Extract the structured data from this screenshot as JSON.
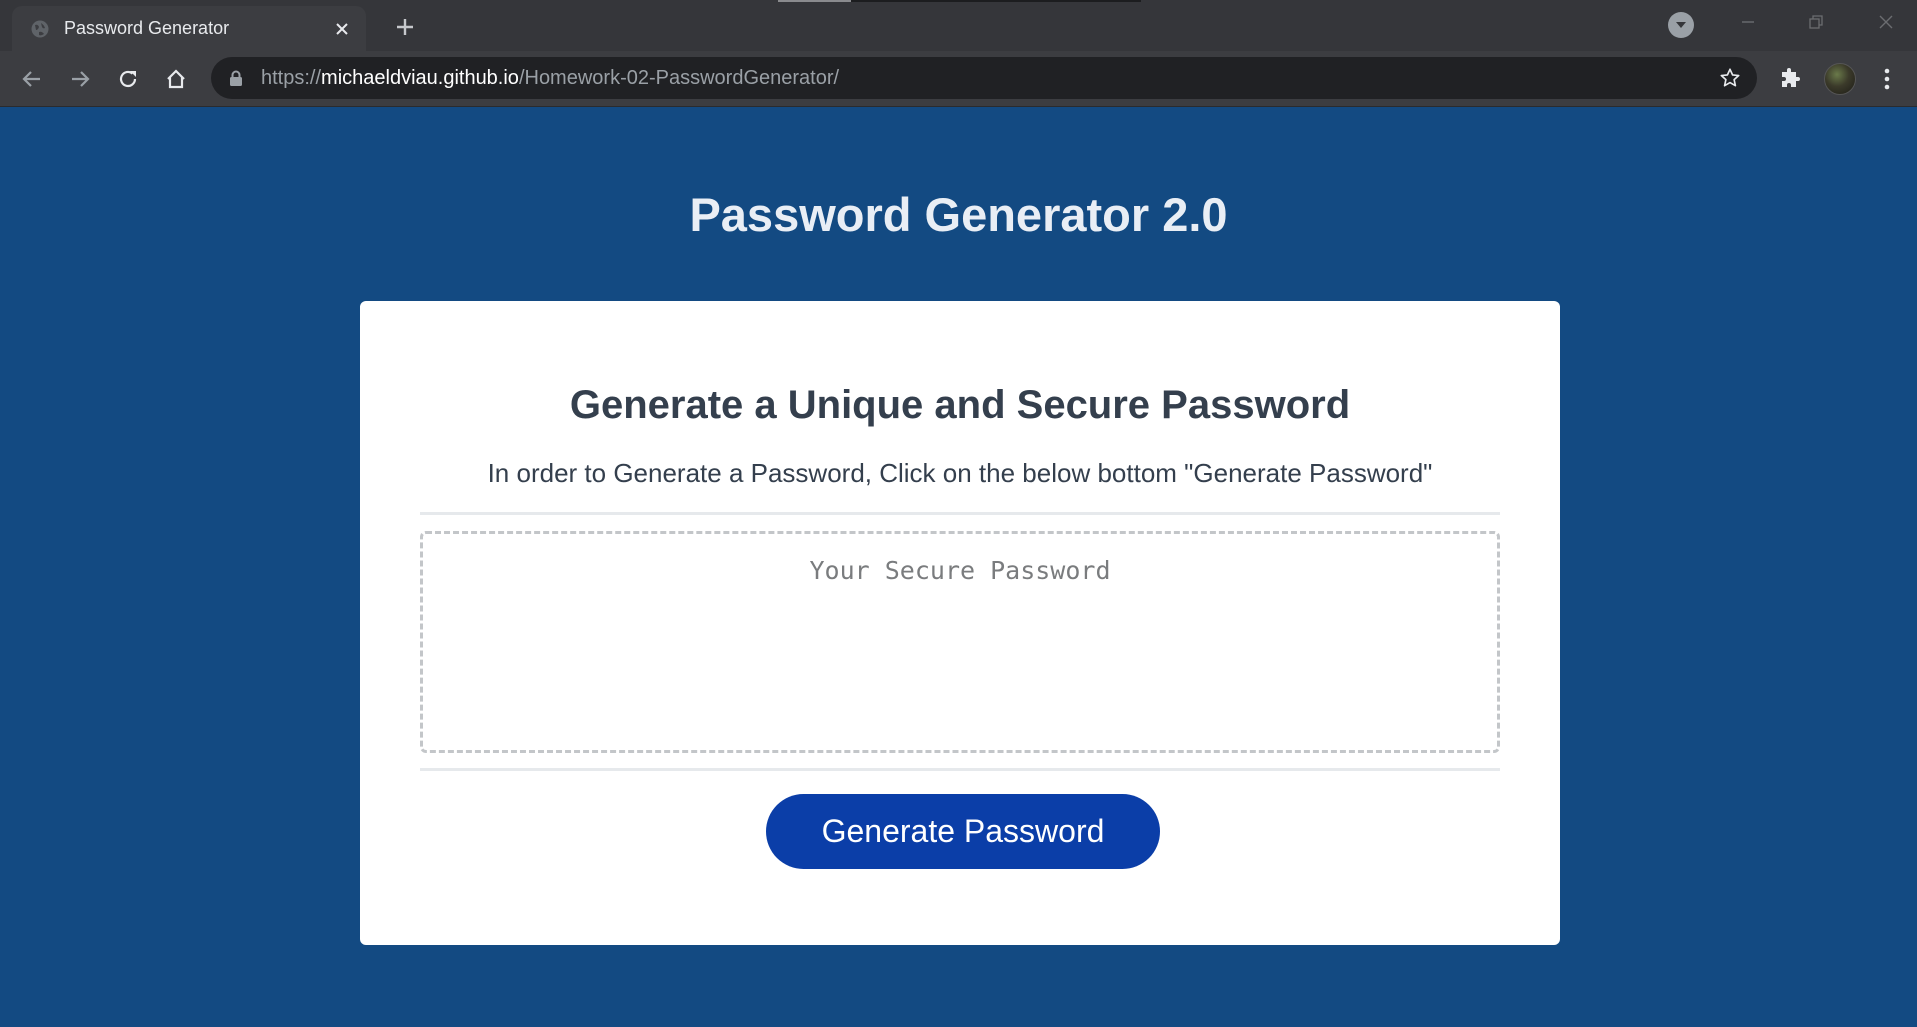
{
  "browser": {
    "tab_title": "Password Generator",
    "url_scheme": "https://",
    "url_host": "michaeldviau.github.io",
    "url_path": "/Homework-02-PasswordGenerator/"
  },
  "page": {
    "title": "Password Generator 2.0",
    "card": {
      "heading": "Generate a Unique and Secure Password",
      "instructions": "In order to Generate a Password, Click on the below bottom \"Generate Password\"",
      "password_placeholder": "Your Secure Password",
      "password_value": "",
      "generate_button_label": "Generate Password"
    }
  },
  "colors": {
    "page_background": "#134a82",
    "card_background": "#ffffff",
    "button_background": "#0b3ea8",
    "text_dark": "#343f4d"
  },
  "icons": {
    "tab_favicon": "globe-icon",
    "tab_close": "close-icon",
    "new_tab": "plus-icon",
    "tab_search": "chevron-down-icon",
    "back": "back-arrow-icon",
    "forward": "forward-arrow-icon",
    "reload": "reload-icon",
    "home": "home-icon",
    "lock": "lock-icon",
    "bookmark": "star-icon",
    "extensions": "puzzle-icon",
    "menu": "kebab-menu-icon"
  }
}
